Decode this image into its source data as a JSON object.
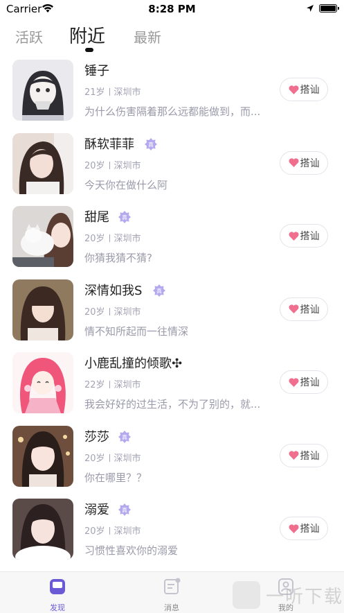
{
  "status_bar": {
    "carrier": "Carrier",
    "time": "8:28 PM"
  },
  "tabs": [
    {
      "label": "活跃",
      "active": false
    },
    {
      "label": "附近",
      "active": true
    },
    {
      "label": "最新",
      "active": false
    }
  ],
  "users": [
    {
      "name": "锤子",
      "verified": false,
      "age": "21岁",
      "city": "深圳市",
      "bio": "为什么伤害隔着那么远都能做到，而...",
      "action": "搭讪"
    },
    {
      "name": "酥软菲菲",
      "verified": true,
      "age": "20岁",
      "city": "深圳市",
      "bio": "今天你在做什么阿",
      "action": "搭讪"
    },
    {
      "name": "甜尾",
      "verified": true,
      "age": "20岁",
      "city": "深圳市",
      "bio": "你猜我猜不猜?",
      "action": "搭讪"
    },
    {
      "name": "深情如我S",
      "verified": true,
      "age": "20岁",
      "city": "深圳市",
      "bio": "情不知所起而一往情深",
      "action": "搭讪"
    },
    {
      "name": "小鹿乱撞的倾歌✣",
      "verified": false,
      "age": "22岁",
      "city": "深圳市",
      "bio": "我会好好的过生活，不为了别的，就...",
      "action": "搭讪"
    },
    {
      "name": "莎莎",
      "verified": true,
      "age": "20岁",
      "city": "深圳市",
      "bio": "你在哪里？？",
      "action": "搭讪"
    },
    {
      "name": "溺爱",
      "verified": true,
      "age": "20岁",
      "city": "深圳市",
      "bio": "习惯性喜欢你的溺爱",
      "action": "搭讪"
    }
  ],
  "tabbar": [
    {
      "label": "发现",
      "icon": "discover-icon",
      "active": true
    },
    {
      "label": "消息",
      "icon": "message-icon",
      "active": false
    },
    {
      "label": "我的",
      "icon": "profile-icon",
      "active": false
    }
  ],
  "watermark": "一听下载",
  "colors": {
    "accent": "#6b5ad6",
    "heart": "#f06f8e",
    "verify_badge": "#9b8ee6"
  }
}
